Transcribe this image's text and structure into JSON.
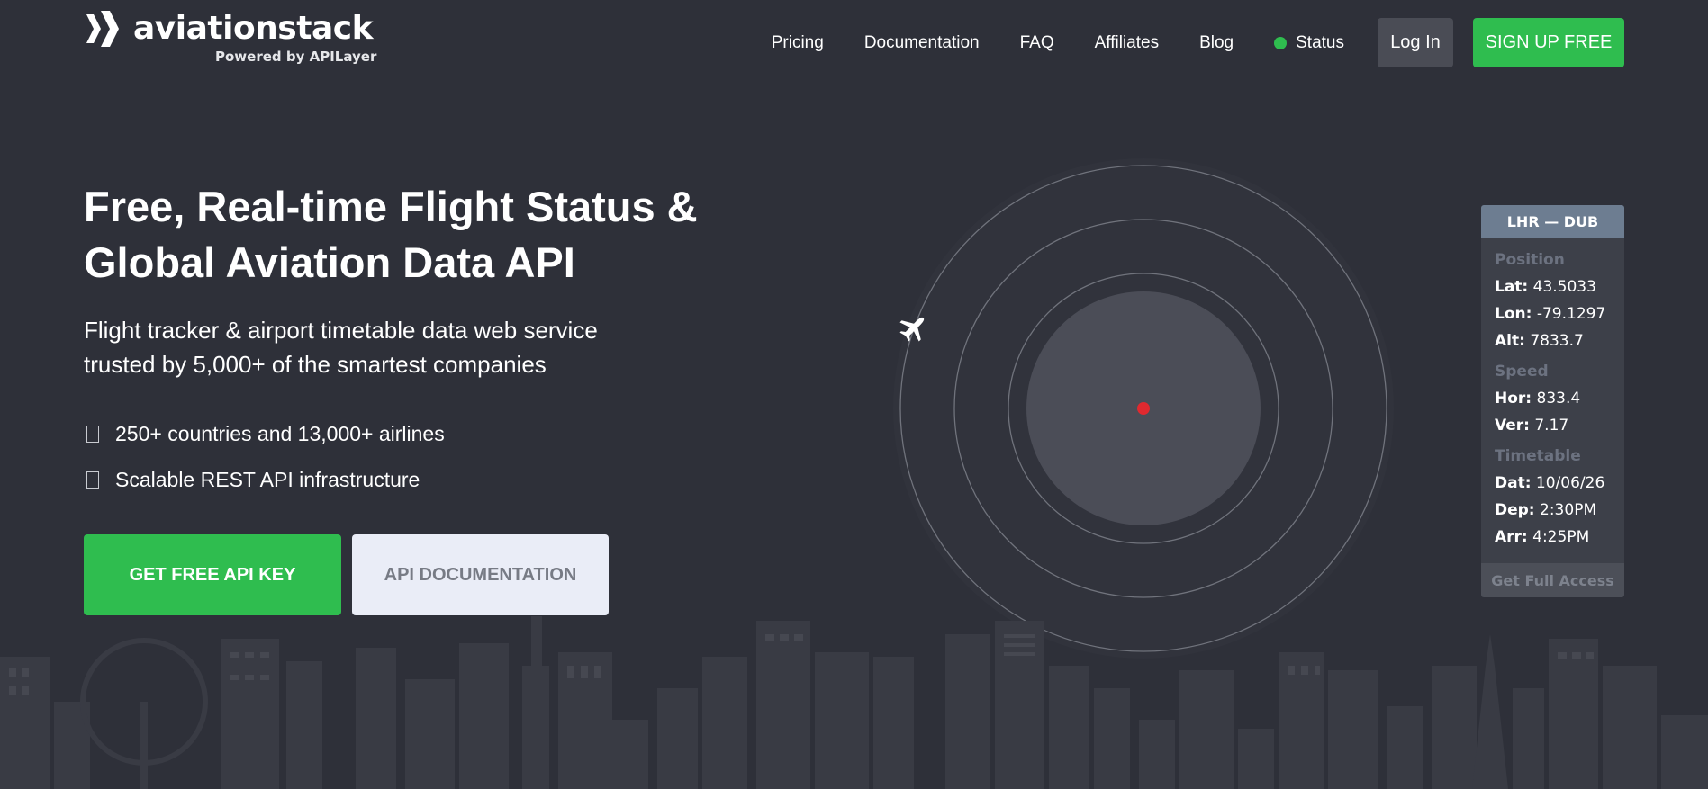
{
  "brand": {
    "name": "aviationstack",
    "tagline": "Powered by APILayer"
  },
  "nav": {
    "links": [
      "Pricing",
      "Documentation",
      "FAQ",
      "Affiliates",
      "Blog"
    ],
    "status_label": "Status",
    "login_label": "Log In",
    "signup_label": "SIGN UP FREE"
  },
  "hero": {
    "title_line1": "Free, Real-time Flight Status &",
    "title_line2": "Global Aviation Data API",
    "subtitle_line1": "Flight tracker & airport timetable data web service",
    "subtitle_line2": "trusted by 5,000+ of the smartest companies",
    "features": [
      "250+ countries and 13,000+ airlines",
      "Scalable REST API infrastructure"
    ],
    "cta_primary": "GET FREE API KEY",
    "cta_secondary": "API DOCUMENTATION"
  },
  "flight_card": {
    "route": "LHR — DUB",
    "position_heading": "Position",
    "lat_label": "Lat:",
    "lat_value": "43.5033",
    "lon_label": "Lon:",
    "lon_value": "-79.1297",
    "alt_label": "Alt:",
    "alt_value": "7833.7",
    "speed_heading": "Speed",
    "hor_label": "Hor:",
    "hor_value": "833.4",
    "ver_label": "Ver:",
    "ver_value": "7.17",
    "timetable_heading": "Timetable",
    "dat_label": "Dat:",
    "dat_value": "10/06/26",
    "dep_label": "Dep:",
    "dep_value": "2:30PM",
    "arr_label": "Arr:",
    "arr_value": "4:25PM",
    "footer": "Get Full Access"
  },
  "colors": {
    "background": "#2e3039",
    "accent_green": "#2fbd4f",
    "radar_dot": "#e0292f",
    "card_header": "#6d7d91"
  },
  "icons": {
    "logo": "chevron-double-logo-icon",
    "status": "status-dot-icon",
    "feature": "checkbox-icon",
    "plane": "airplane-icon"
  }
}
